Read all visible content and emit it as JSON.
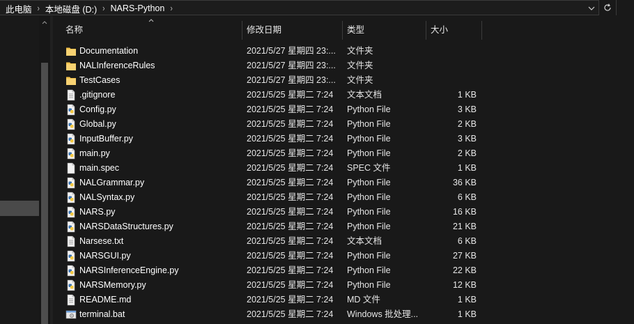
{
  "address": {
    "crumbs": [
      "此电脑",
      "本地磁盘 (D:)",
      "NARS-Python"
    ],
    "separator": "›"
  },
  "columns": {
    "name": "名称",
    "date": "修改日期",
    "type": "类型",
    "size": "大小"
  },
  "colors": {
    "background": "#191919",
    "folder": "#f4c34c",
    "text": "#ffffff",
    "secondary_text": "#e6e6e6",
    "selection": "#4a4a4a"
  },
  "files": [
    {
      "name": "Documentation",
      "date": "2021/5/27 星期四 23:...",
      "type": "文件夹",
      "size": "",
      "icon": "folder-icon"
    },
    {
      "name": "NALInferenceRules",
      "date": "2021/5/27 星期四 23:...",
      "type": "文件夹",
      "size": "",
      "icon": "folder-icon"
    },
    {
      "name": "TestCases",
      "date": "2021/5/27 星期四 23:...",
      "type": "文件夹",
      "size": "",
      "icon": "folder-icon"
    },
    {
      "name": ".gitignore",
      "date": "2021/5/25 星期二 7:24",
      "type": "文本文档",
      "size": "1 KB",
      "icon": "text-file-icon"
    },
    {
      "name": "Config.py",
      "date": "2021/5/25 星期二 7:24",
      "type": "Python File",
      "size": "3 KB",
      "icon": "python-file-icon"
    },
    {
      "name": "Global.py",
      "date": "2021/5/25 星期二 7:24",
      "type": "Python File",
      "size": "2 KB",
      "icon": "python-file-icon"
    },
    {
      "name": "InputBuffer.py",
      "date": "2021/5/25 星期二 7:24",
      "type": "Python File",
      "size": "3 KB",
      "icon": "python-file-icon"
    },
    {
      "name": "main.py",
      "date": "2021/5/25 星期二 7:24",
      "type": "Python File",
      "size": "2 KB",
      "icon": "python-file-icon"
    },
    {
      "name": "main.spec",
      "date": "2021/5/25 星期二 7:24",
      "type": "SPEC 文件",
      "size": "1 KB",
      "icon": "blank-file-icon"
    },
    {
      "name": "NALGrammar.py",
      "date": "2021/5/25 星期二 7:24",
      "type": "Python File",
      "size": "36 KB",
      "icon": "python-file-icon"
    },
    {
      "name": "NALSyntax.py",
      "date": "2021/5/25 星期二 7:24",
      "type": "Python File",
      "size": "6 KB",
      "icon": "python-file-icon"
    },
    {
      "name": "NARS.py",
      "date": "2021/5/25 星期二 7:24",
      "type": "Python File",
      "size": "16 KB",
      "icon": "python-file-icon"
    },
    {
      "name": "NARSDataStructures.py",
      "date": "2021/5/25 星期二 7:24",
      "type": "Python File",
      "size": "21 KB",
      "icon": "python-file-icon"
    },
    {
      "name": "Narsese.txt",
      "date": "2021/5/25 星期二 7:24",
      "type": "文本文档",
      "size": "6 KB",
      "icon": "text-file-icon"
    },
    {
      "name": "NARSGUI.py",
      "date": "2021/5/25 星期二 7:24",
      "type": "Python File",
      "size": "27 KB",
      "icon": "python-file-icon"
    },
    {
      "name": "NARSInferenceEngine.py",
      "date": "2021/5/25 星期二 7:24",
      "type": "Python File",
      "size": "22 KB",
      "icon": "python-file-icon"
    },
    {
      "name": "NARSMemory.py",
      "date": "2021/5/25 星期二 7:24",
      "type": "Python File",
      "size": "12 KB",
      "icon": "python-file-icon"
    },
    {
      "name": "README.md",
      "date": "2021/5/25 星期二 7:24",
      "type": "MD 文件",
      "size": "1 KB",
      "icon": "text-file-icon"
    },
    {
      "name": "terminal.bat",
      "date": "2021/5/25 星期二 7:24",
      "type": "Windows 批处理...",
      "size": "1 KB",
      "icon": "batch-file-icon"
    }
  ]
}
